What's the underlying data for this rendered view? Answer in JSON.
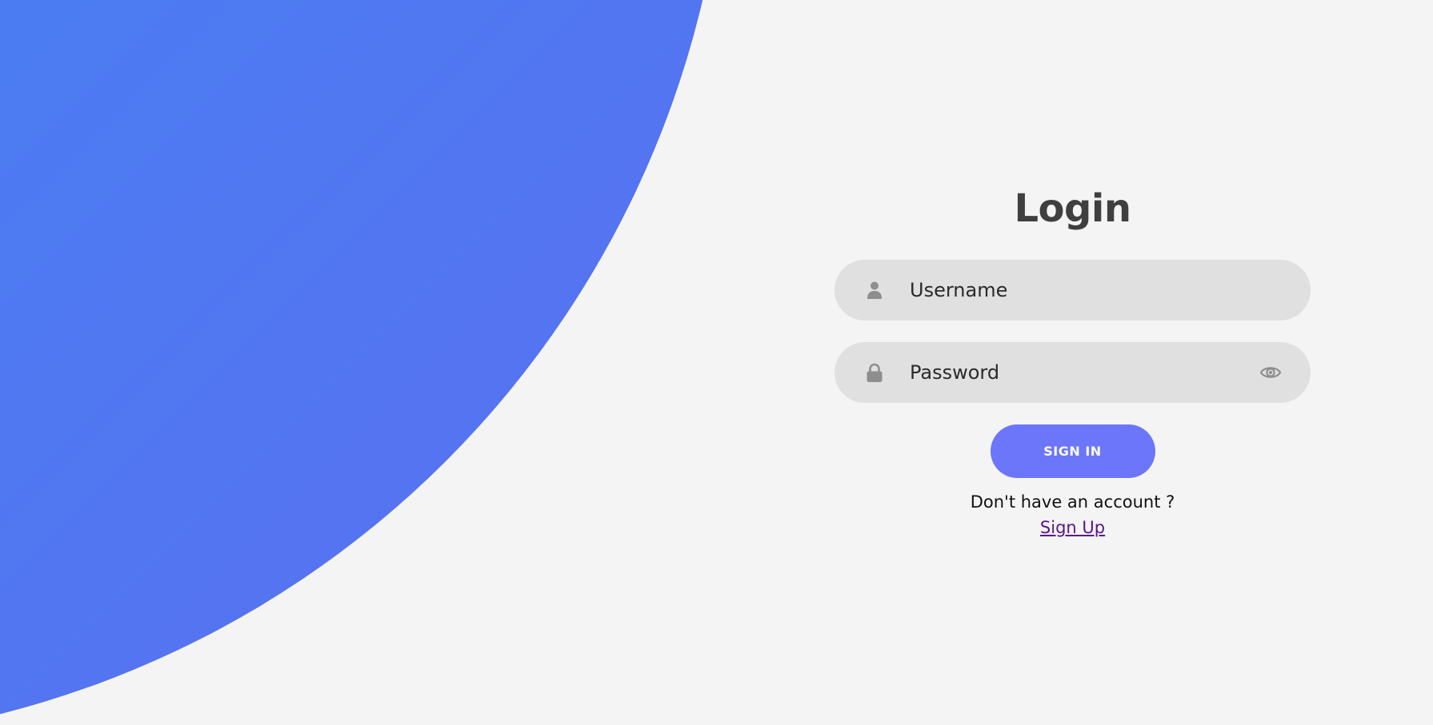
{
  "login": {
    "title": "Login",
    "username": {
      "value": "",
      "placeholder": "Username",
      "icon": "user-icon"
    },
    "password": {
      "value": "",
      "placeholder": "Password",
      "icon": "lock-icon",
      "toggle_icon": "eye-icon"
    },
    "submit_label": "SIGN IN",
    "signup_prompt": "Don't have an account ?",
    "signup_link": "Sign Up"
  },
  "colors": {
    "background": "#f4f4f5",
    "blob_gradient_start": "#3b8cf7",
    "blob_gradient_end": "#5b6ef0",
    "field_background": "#e0e0e0",
    "button": "#6c76fb",
    "title": "#3f3f3f",
    "link": "#5b1390",
    "icon": "#8e8e8e"
  }
}
